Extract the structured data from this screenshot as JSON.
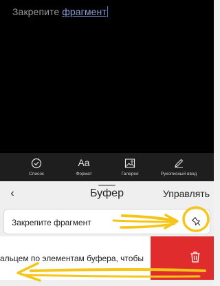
{
  "editor": {
    "text_plain": "Закрепите ",
    "text_underlined": "фрагмент"
  },
  "toolbar": {
    "list_label": "Список",
    "format_glyph": "Aa",
    "format_label": "Формат",
    "gallery_label": "Галерея",
    "handwriting_label": "Рукописный ввод"
  },
  "clipboard": {
    "back_glyph": "‹",
    "title": "Буфер",
    "manage_label": "Управлять",
    "items": [
      {
        "text": "Закрепите фрагмент"
      },
      {
        "text": "альцем по элементам буфера, чтобы"
      }
    ]
  },
  "colors": {
    "editor_bg": "#000000",
    "toolbar_bg": "#1e1e1e",
    "panel_bg": "#efefef",
    "delete_red": "#e02c2c",
    "annotation_yellow": "#f5c518"
  },
  "icons": [
    "check-circle-icon",
    "gallery-icon",
    "pen-icon",
    "pin-icon",
    "trash-icon",
    "chevron-left-icon"
  ]
}
